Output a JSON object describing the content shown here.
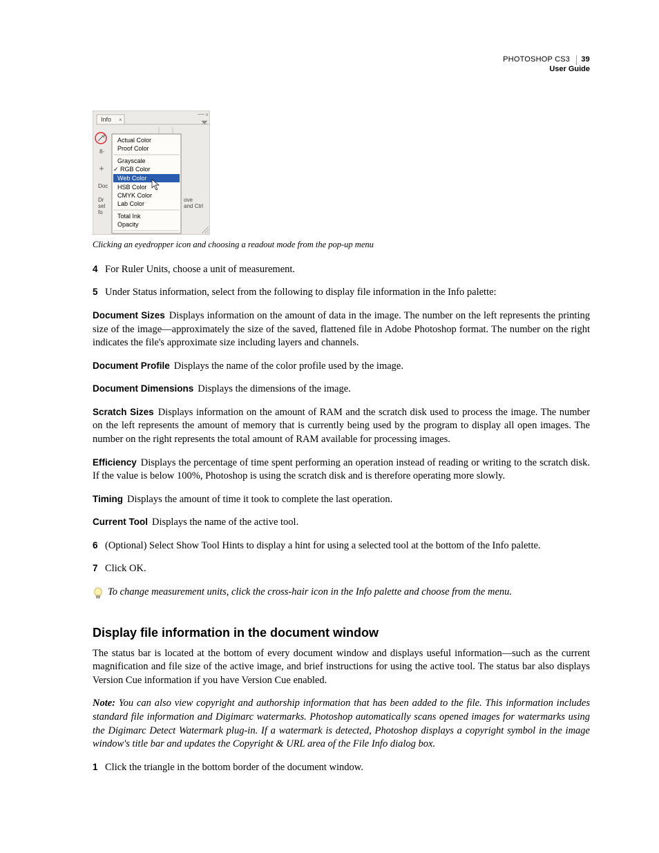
{
  "header": {
    "product": "PHOTOSHOP CS3",
    "doc": "User Guide",
    "page": "39"
  },
  "figure": {
    "tab_label": "Info",
    "menu": {
      "actual": "Actual Color",
      "proof": "Proof Color",
      "grayscale": "Grayscale",
      "rgb": "RGB Color",
      "web": "Web Color",
      "hsb": "HSB Color",
      "cmyk": "CMYK Color",
      "lab": "Lab Color",
      "totalink": "Total Ink",
      "opacity": "Opacity"
    },
    "side": {
      "doc": "Doc",
      "dr": "Dr",
      "sel": "sel",
      "fo": "fo",
      "ove": "ove",
      "ctrl": "and Ctrl"
    }
  },
  "caption": "Clicking an eyedropper icon and choosing a readout mode from the pop-up menu",
  "steps": {
    "s4_num": "4",
    "s4": "For Ruler Units, choose a unit of measurement.",
    "s5_num": "5",
    "s5": "Under Status information, select from the following to display file information in the Info palette:",
    "s6_num": "6",
    "s6": "(Optional) Select Show Tool Hints to display a hint for using a selected tool at the bottom of the Info palette.",
    "s7_num": "7",
    "s7": "Click OK.",
    "sB1_num": "1",
    "sB1": "Click the triangle in the bottom border of the document window."
  },
  "defs": {
    "docSizes": {
      "term": "Document Sizes",
      "text": "Displays information on the amount of data in the image. The number on the left represents the printing size of the image—approximately the size of the saved, flattened file in Adobe Photoshop format. The number on the right indicates the file's approximate size including layers and channels."
    },
    "docProfile": {
      "term": "Document Profile",
      "text": "Displays the name of the color profile used by the image."
    },
    "docDims": {
      "term": "Document Dimensions",
      "text": "Displays the dimensions of the image."
    },
    "scratch": {
      "term": "Scratch Sizes",
      "text": "Displays information on the amount of RAM and the scratch disk used to process the image. The number on the left represents the amount of memory that is currently being used by the program to display all open images. The number on the right represents the total amount of RAM available for processing images."
    },
    "efficiency": {
      "term": "Efficiency",
      "text": "Displays the percentage of time spent performing an operation instead of reading or writing to the scratch disk. If the value is below 100%, Photoshop is using the scratch disk and is therefore operating more slowly."
    },
    "timing": {
      "term": "Timing",
      "text": "Displays the amount of time it took to complete the last operation."
    },
    "currentTool": {
      "term": "Current Tool",
      "text": "Displays the name of the active tool."
    }
  },
  "tip": "To change measurement units, click the cross-hair icon in the Info palette and choose from the menu.",
  "section2": {
    "heading": "Display file information in the document window",
    "p1": "The status bar is located at the bottom of every document window and displays useful information—such as the current magnification and file size of the active image, and brief instructions for using the active tool. The status bar also displays Version Cue information if you have Version Cue enabled.",
    "note_label": "Note:",
    "note": "You can also view copyright and authorship information that has been added to the file. This information includes standard file information and Digimarc watermarks. Photoshop automatically scans opened images for watermarks using the Digimarc Detect Watermark plug-in. If a watermark is detected, Photoshop displays a copyright symbol in the image window's title bar and updates the Copyright & URL area of the File Info dialog box."
  }
}
